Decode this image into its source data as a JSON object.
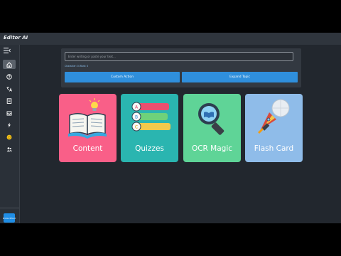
{
  "app": {
    "title": "Editor AI",
    "badge_text": "ProductHunt"
  },
  "sidebar": {
    "items": [
      {
        "name": "home-icon",
        "active": true
      },
      {
        "name": "help-icon",
        "active": false
      },
      {
        "name": "translate-icon",
        "active": false
      },
      {
        "name": "document-icon",
        "active": false
      },
      {
        "name": "inbox-icon",
        "active": false
      },
      {
        "name": "bolt-icon",
        "active": false
      },
      {
        "name": "coin-icon",
        "active": false
      },
      {
        "name": "users-icon",
        "active": false
      }
    ]
  },
  "editor": {
    "placeholder": "Enter writing or paste your text...",
    "counter_text": "Character: 0  Word: 0",
    "custom_action_label": "Custom Action",
    "expand_topic_label": "Expand Topic"
  },
  "cards": [
    {
      "label": "Content",
      "color": "#f95f88",
      "icon": "book-lightbulb-icon"
    },
    {
      "label": "Quizzes",
      "color": "#2ab5b0",
      "icon": "quiz-options-icon"
    },
    {
      "label": "OCR Magic",
      "color": "#5fd497",
      "icon": "magnifier-book-icon"
    },
    {
      "label": "Flash Card",
      "color": "#8fbce9",
      "icon": "rocket-icon"
    }
  ],
  "colors": {
    "background": "#22272e",
    "accent": "#2f8fdc"
  }
}
